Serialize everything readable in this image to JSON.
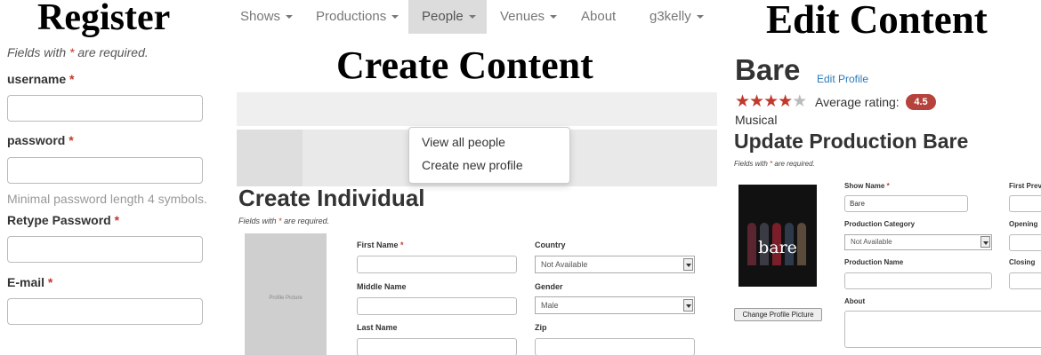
{
  "headings": {
    "register": "Register",
    "create": "Create Content",
    "edit": "Edit Content"
  },
  "register": {
    "required_note_prefix": "Fields with",
    "required_note_star": "*",
    "required_note_suffix": "are required.",
    "username_label": "username",
    "password_label": "password",
    "password_hint": "Minimal password length 4 symbols.",
    "retype_label": "Retype Password",
    "email_label": "E-mail",
    "required_star": "*"
  },
  "navbar": {
    "items": [
      "Shows",
      "Productions",
      "People",
      "Venues",
      "About",
      "g3kelly"
    ],
    "active": "People",
    "dropdown": [
      "View all people",
      "Create new profile"
    ]
  },
  "create_form": {
    "title": "Create Individual",
    "required_note_prefix": "Fields with",
    "required_note_star": "*",
    "required_note_suffix": "are required.",
    "picture_label": "Profile Picture",
    "first_name_label": "First Name",
    "middle_name_label": "Middle Name",
    "last_name_label": "Last Name",
    "country_label": "Country",
    "country_value": "Not Available",
    "gender_label": "Gender",
    "gender_value": "Male",
    "zip_label": "Zip",
    "required_star": "*"
  },
  "edit": {
    "title": "Bare",
    "edit_link": "Edit Profile",
    "rating_label": "Average rating:",
    "rating_value": "4.5",
    "rating_stars": 4.5,
    "genre": "Musical",
    "form_title": "Update Production Bare",
    "required_note_prefix": "Fields with",
    "required_note_star": "*",
    "required_note_suffix": "are required.",
    "show_name_label": "Show Name",
    "show_name_value": "Bare",
    "first_preview_label": "First Prev",
    "category_label": "Production Category",
    "category_value": "Not Available",
    "opening_label": "Opening",
    "production_name_label": "Production Name",
    "closing_label": "Closing",
    "about_label": "About",
    "poster_word": "bare",
    "change_picture_button": "Change Profile Picture",
    "required_star": "*"
  },
  "colors": {
    "required": "#c0392b",
    "badge": "#b5433b",
    "link": "#2a7ab8"
  }
}
